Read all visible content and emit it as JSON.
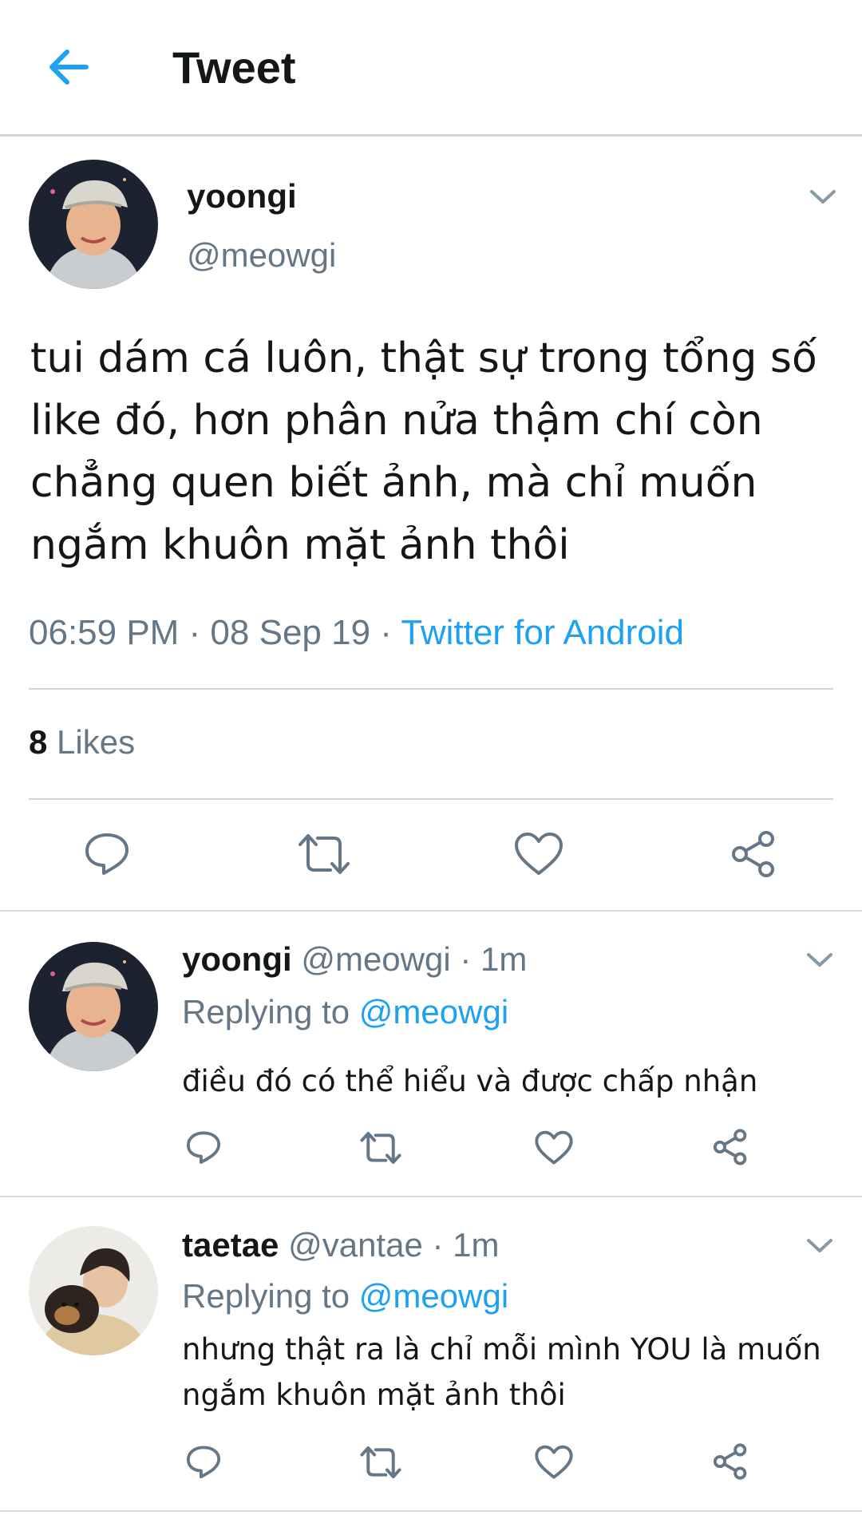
{
  "header": {
    "title": "Tweet",
    "back_icon": "back-arrow-icon"
  },
  "tweet": {
    "name": "yoongi",
    "handle": "@meowgi",
    "text": "tui dám cá luôn, thật sự trong tổng số like đó, hơn phân nửa thậm chí còn chẳng quen biết ảnh, mà chỉ muốn ngắm khuôn mặt ảnh thôi",
    "time": "06:59 PM · 08 Sep 19 · ",
    "source": "Twitter for Android",
    "likes_count": "8",
    "likes_label": " Likes"
  },
  "actions": [
    "reply-icon",
    "retweet-icon",
    "like-icon",
    "share-icon"
  ],
  "replies": [
    {
      "name": "yoongi",
      "handle": "@meowgi · 1m",
      "replying_label": "Replying to ",
      "replying_to": "@meowgi",
      "text": "điều đó có thể hiểu và được chấp nhận"
    },
    {
      "name": "taetae",
      "handle": "@vantae · 1m",
      "replying_label": "Replying to ",
      "replying_to": "@meowgi",
      "text": "nhưng thật ra là chỉ mỗi mình YOU là muốn ngắm khuôn mặt ảnh thôi"
    }
  ],
  "colors": {
    "accent": "#1da1f2",
    "secondary_text": "#657786",
    "icon": "#657786",
    "divider": "#cfd5db"
  }
}
